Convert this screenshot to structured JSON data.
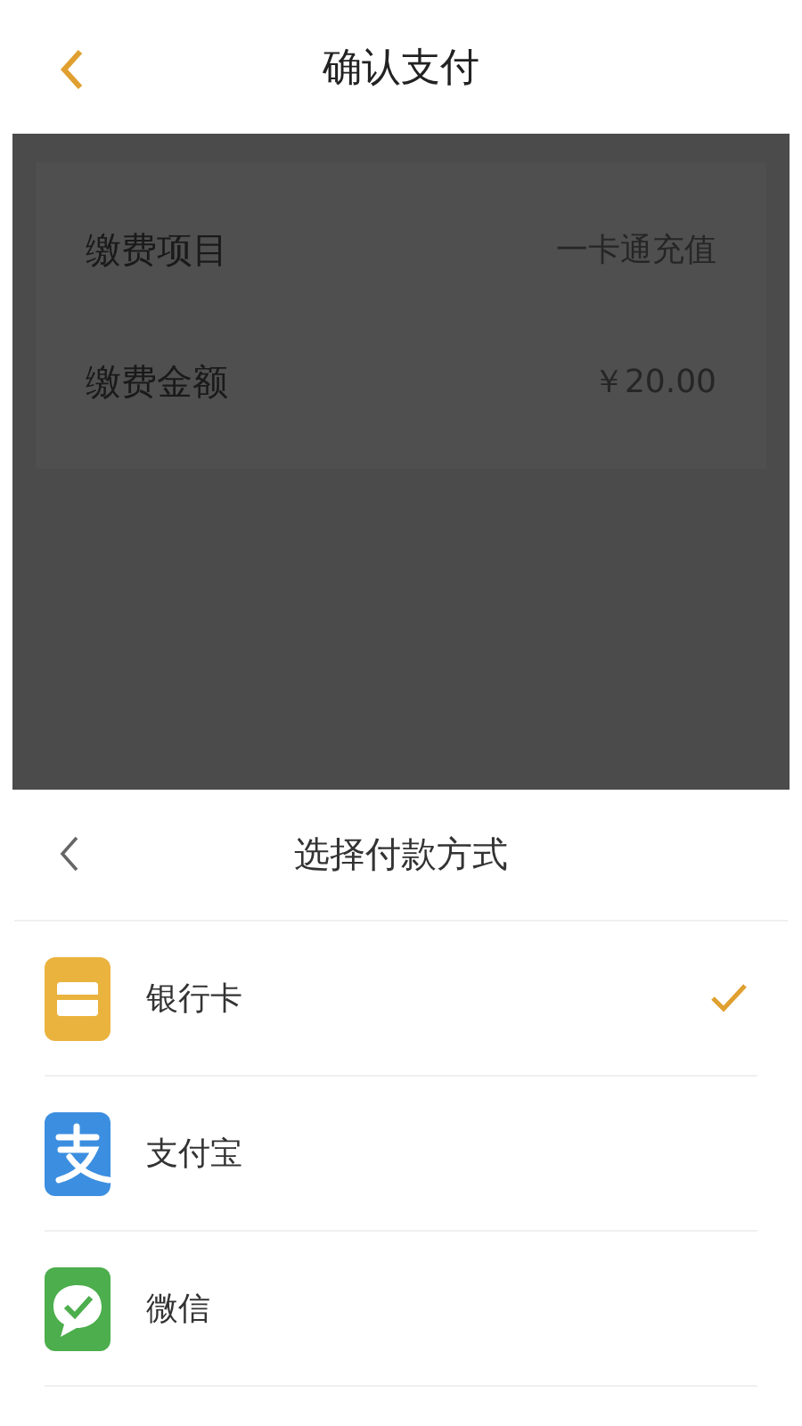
{
  "header": {
    "title": "确认支付"
  },
  "details": [
    {
      "label": "缴费项目",
      "value": "一卡通充值"
    },
    {
      "label": "缴费金额",
      "value": "￥20.00"
    }
  ],
  "sheet": {
    "title": "选择付款方式",
    "methods": [
      {
        "kind": "bank_card",
        "label": "银行卡",
        "selected": true
      },
      {
        "kind": "alipay",
        "label": "支付宝",
        "selected": false
      },
      {
        "kind": "wechat",
        "label": "微信",
        "selected": false
      }
    ]
  }
}
